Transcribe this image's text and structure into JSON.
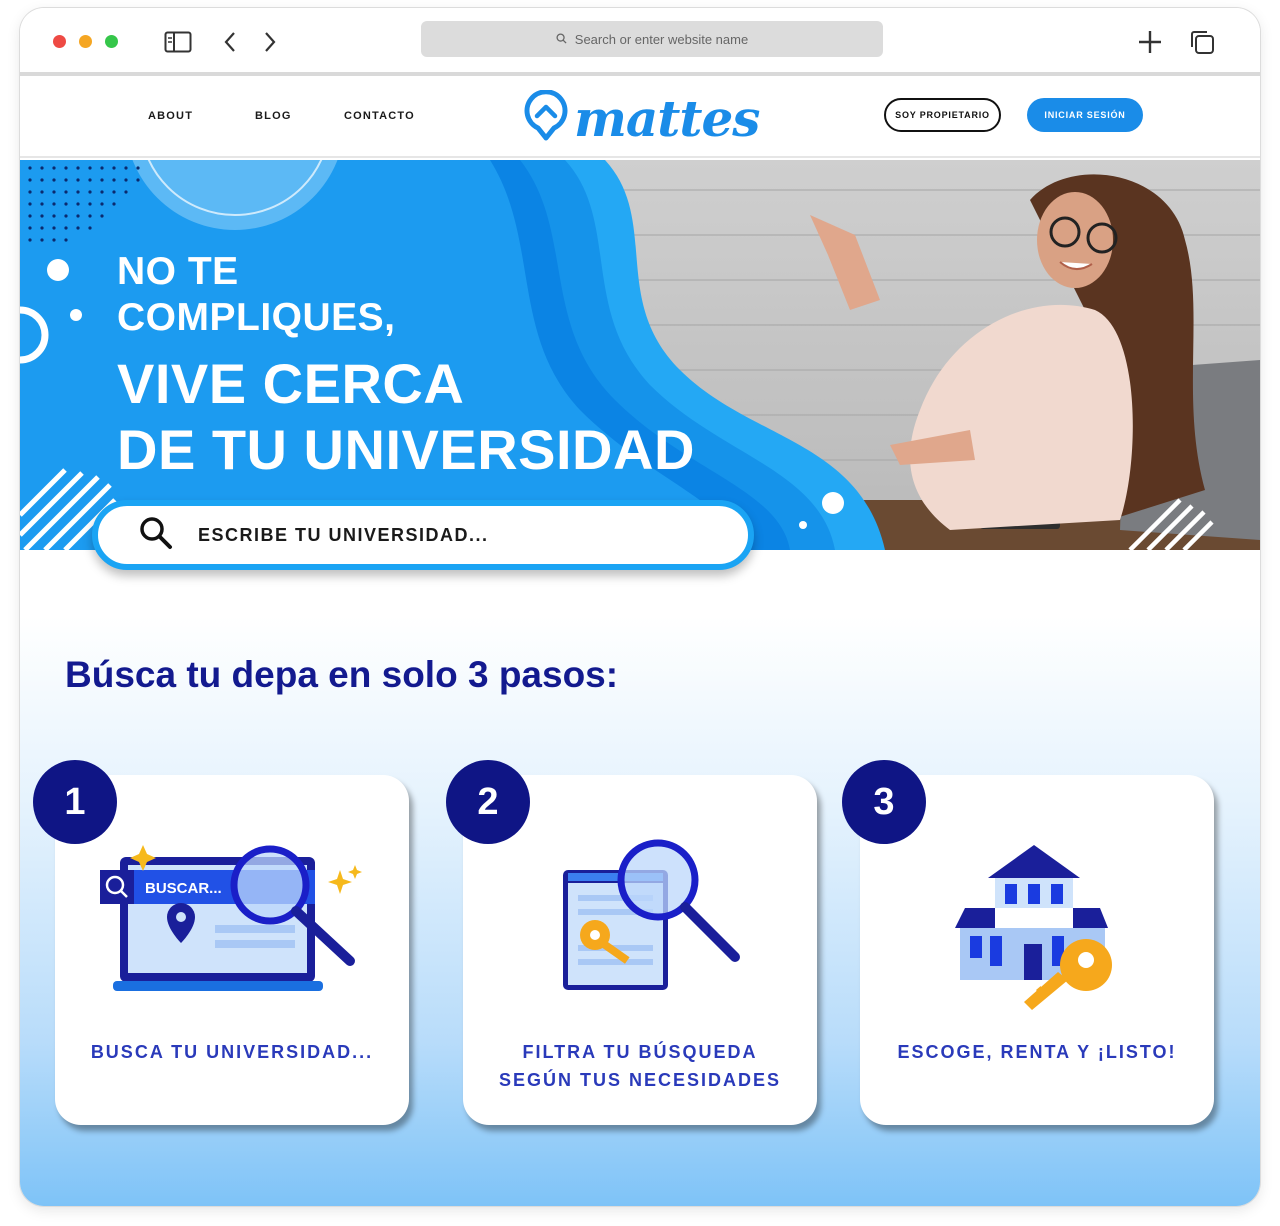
{
  "browser": {
    "url_placeholder": "Search or enter website name"
  },
  "nav": {
    "about": "ABOUT",
    "blog": "BLOG",
    "contacto": "CONTACTO",
    "logo": "mattes",
    "owner_button": "SOY PROPIETARIO",
    "login_button": "INICIAR SESIÓN"
  },
  "hero": {
    "line1": "NO TE",
    "line2": "COMPLIQUES,",
    "line3": "VIVE CERCA",
    "line4": "DE TU UNIVERSIDAD",
    "search_placeholder": "ESCRIBE TU UNIVERSIDAD..."
  },
  "steps": {
    "title": "Búsca tu depa en solo 3 pasos:",
    "items": [
      {
        "number": "1",
        "illustration_text": "BUSCAR...",
        "caption_line1": "BUSCA TU UNIVERSIDAD...",
        "caption_line2": ""
      },
      {
        "number": "2",
        "caption_line1": "FILTRA TU BÚSQUEDA",
        "caption_line2": "SEGÚN TUS NECESIDADES"
      },
      {
        "number": "3",
        "caption_line1": "ESCOGE, RENTA Y ¡LISTO!",
        "caption_line2": ""
      }
    ]
  },
  "colors": {
    "brand_blue": "#1a8ce8",
    "navy": "#0f1585",
    "title_navy": "#131a8f"
  }
}
